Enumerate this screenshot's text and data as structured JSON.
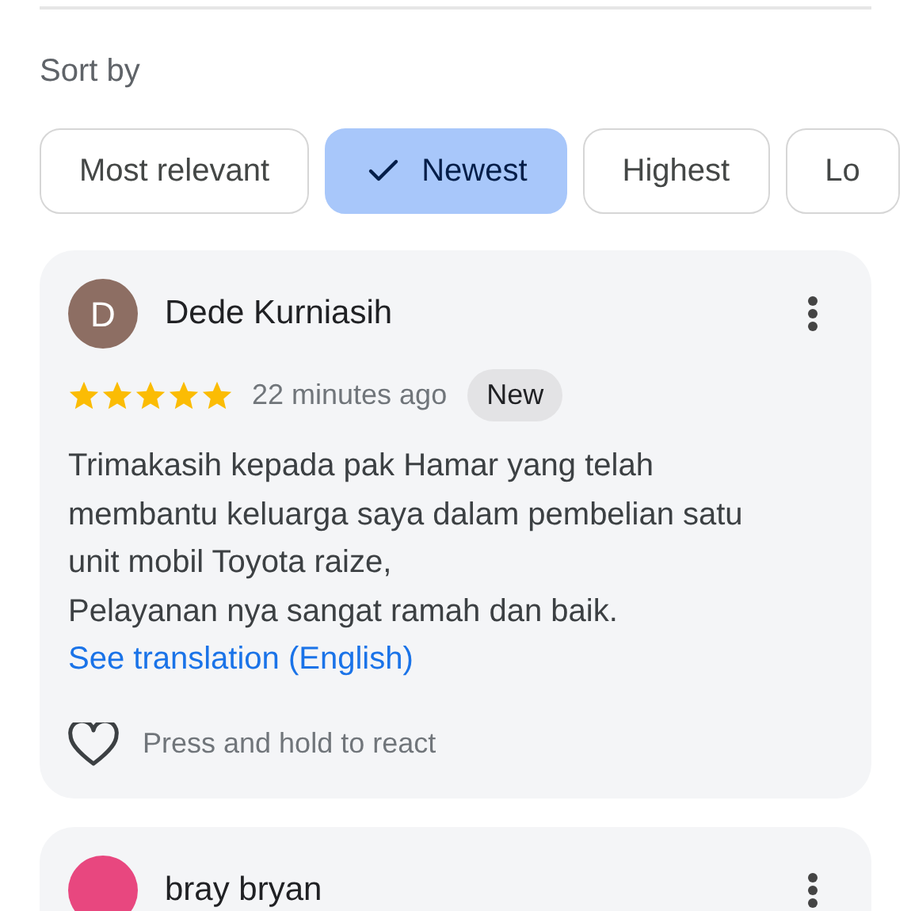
{
  "sort": {
    "label": "Sort by",
    "options": [
      {
        "label": "Most relevant",
        "selected": false
      },
      {
        "label": "Newest",
        "selected": true
      },
      {
        "label": "Highest",
        "selected": false
      },
      {
        "label": "Lo",
        "selected": false
      }
    ]
  },
  "reviews": [
    {
      "initial": "D",
      "color": "#8d6e63",
      "author": "Dede Kurniasih",
      "stars": 5,
      "time": "22 minutes ago",
      "badge": "New",
      "text": [
        "Trimakasih kepada pak Hamar yang telah membantu keluarga saya dalam pembelian satu unit mobil Toyota raize,",
        "Pelayanan nya sangat ramah dan baik."
      ],
      "translate": "See translation (English)",
      "react_hint": "Press and hold to react"
    },
    {
      "color": "#e8477f",
      "author": "bray bryan"
    }
  ]
}
